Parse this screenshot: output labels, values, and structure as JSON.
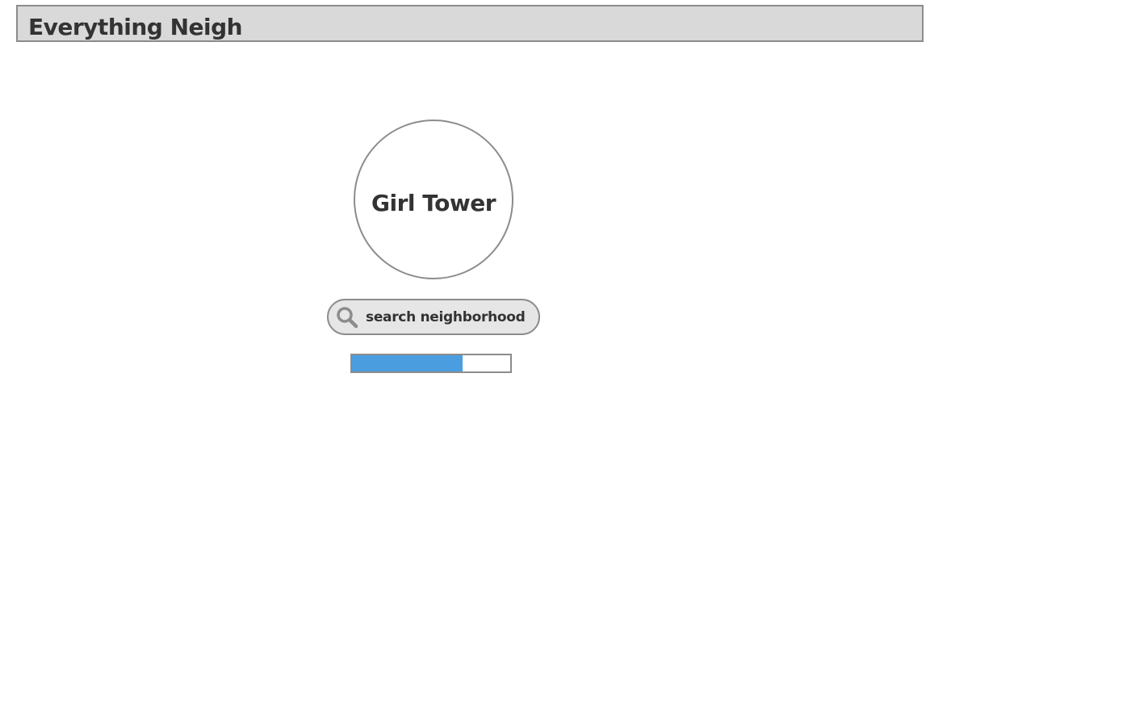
{
  "app": {
    "title": "Everything Neigh"
  },
  "main": {
    "circle_label": "Girl Tower",
    "search": {
      "placeholder": "search neighborhood",
      "value": "",
      "icon": "search-icon"
    },
    "progress": {
      "value": 0.7,
      "fill_color": "#4a9ee0"
    }
  },
  "colors": {
    "header_bg": "#d9d9d9",
    "border": "#8c8c8c",
    "text": "#333333",
    "search_bg": "#e6e6e6",
    "accent": "#4a9ee0"
  }
}
